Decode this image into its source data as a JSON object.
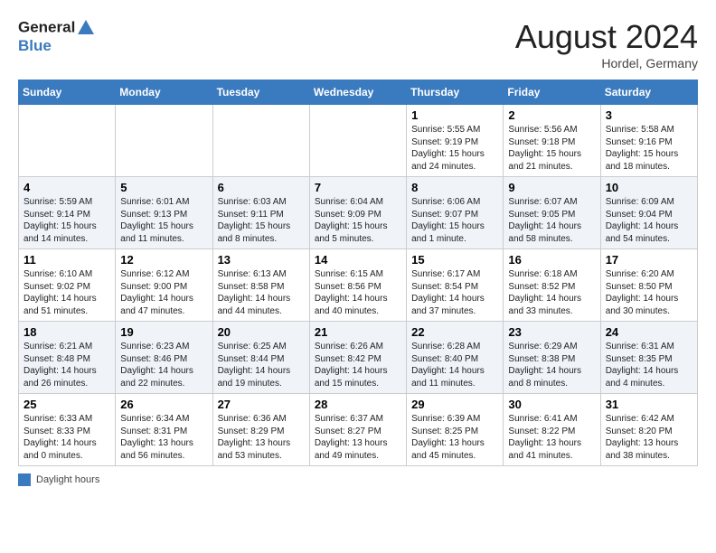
{
  "header": {
    "logo_line1": "General",
    "logo_line2": "Blue",
    "month_title": "August 2024",
    "location": "Hordel, Germany"
  },
  "days_of_week": [
    "Sunday",
    "Monday",
    "Tuesday",
    "Wednesday",
    "Thursday",
    "Friday",
    "Saturday"
  ],
  "weeks": [
    [
      {
        "day": "",
        "content": ""
      },
      {
        "day": "",
        "content": ""
      },
      {
        "day": "",
        "content": ""
      },
      {
        "day": "",
        "content": ""
      },
      {
        "day": "1",
        "content": "Sunrise: 5:55 AM\nSunset: 9:19 PM\nDaylight: 15 hours\nand 24 minutes."
      },
      {
        "day": "2",
        "content": "Sunrise: 5:56 AM\nSunset: 9:18 PM\nDaylight: 15 hours\nand 21 minutes."
      },
      {
        "day": "3",
        "content": "Sunrise: 5:58 AM\nSunset: 9:16 PM\nDaylight: 15 hours\nand 18 minutes."
      }
    ],
    [
      {
        "day": "4",
        "content": "Sunrise: 5:59 AM\nSunset: 9:14 PM\nDaylight: 15 hours\nand 14 minutes."
      },
      {
        "day": "5",
        "content": "Sunrise: 6:01 AM\nSunset: 9:13 PM\nDaylight: 15 hours\nand 11 minutes."
      },
      {
        "day": "6",
        "content": "Sunrise: 6:03 AM\nSunset: 9:11 PM\nDaylight: 15 hours\nand 8 minutes."
      },
      {
        "day": "7",
        "content": "Sunrise: 6:04 AM\nSunset: 9:09 PM\nDaylight: 15 hours\nand 5 minutes."
      },
      {
        "day": "8",
        "content": "Sunrise: 6:06 AM\nSunset: 9:07 PM\nDaylight: 15 hours\nand 1 minute."
      },
      {
        "day": "9",
        "content": "Sunrise: 6:07 AM\nSunset: 9:05 PM\nDaylight: 14 hours\nand 58 minutes."
      },
      {
        "day": "10",
        "content": "Sunrise: 6:09 AM\nSunset: 9:04 PM\nDaylight: 14 hours\nand 54 minutes."
      }
    ],
    [
      {
        "day": "11",
        "content": "Sunrise: 6:10 AM\nSunset: 9:02 PM\nDaylight: 14 hours\nand 51 minutes."
      },
      {
        "day": "12",
        "content": "Sunrise: 6:12 AM\nSunset: 9:00 PM\nDaylight: 14 hours\nand 47 minutes."
      },
      {
        "day": "13",
        "content": "Sunrise: 6:13 AM\nSunset: 8:58 PM\nDaylight: 14 hours\nand 44 minutes."
      },
      {
        "day": "14",
        "content": "Sunrise: 6:15 AM\nSunset: 8:56 PM\nDaylight: 14 hours\nand 40 minutes."
      },
      {
        "day": "15",
        "content": "Sunrise: 6:17 AM\nSunset: 8:54 PM\nDaylight: 14 hours\nand 37 minutes."
      },
      {
        "day": "16",
        "content": "Sunrise: 6:18 AM\nSunset: 8:52 PM\nDaylight: 14 hours\nand 33 minutes."
      },
      {
        "day": "17",
        "content": "Sunrise: 6:20 AM\nSunset: 8:50 PM\nDaylight: 14 hours\nand 30 minutes."
      }
    ],
    [
      {
        "day": "18",
        "content": "Sunrise: 6:21 AM\nSunset: 8:48 PM\nDaylight: 14 hours\nand 26 minutes."
      },
      {
        "day": "19",
        "content": "Sunrise: 6:23 AM\nSunset: 8:46 PM\nDaylight: 14 hours\nand 22 minutes."
      },
      {
        "day": "20",
        "content": "Sunrise: 6:25 AM\nSunset: 8:44 PM\nDaylight: 14 hours\nand 19 minutes."
      },
      {
        "day": "21",
        "content": "Sunrise: 6:26 AM\nSunset: 8:42 PM\nDaylight: 14 hours\nand 15 minutes."
      },
      {
        "day": "22",
        "content": "Sunrise: 6:28 AM\nSunset: 8:40 PM\nDaylight: 14 hours\nand 11 minutes."
      },
      {
        "day": "23",
        "content": "Sunrise: 6:29 AM\nSunset: 8:38 PM\nDaylight: 14 hours\nand 8 minutes."
      },
      {
        "day": "24",
        "content": "Sunrise: 6:31 AM\nSunset: 8:35 PM\nDaylight: 14 hours\nand 4 minutes."
      }
    ],
    [
      {
        "day": "25",
        "content": "Sunrise: 6:33 AM\nSunset: 8:33 PM\nDaylight: 14 hours\nand 0 minutes."
      },
      {
        "day": "26",
        "content": "Sunrise: 6:34 AM\nSunset: 8:31 PM\nDaylight: 13 hours\nand 56 minutes."
      },
      {
        "day": "27",
        "content": "Sunrise: 6:36 AM\nSunset: 8:29 PM\nDaylight: 13 hours\nand 53 minutes."
      },
      {
        "day": "28",
        "content": "Sunrise: 6:37 AM\nSunset: 8:27 PM\nDaylight: 13 hours\nand 49 minutes."
      },
      {
        "day": "29",
        "content": "Sunrise: 6:39 AM\nSunset: 8:25 PM\nDaylight: 13 hours\nand 45 minutes."
      },
      {
        "day": "30",
        "content": "Sunrise: 6:41 AM\nSunset: 8:22 PM\nDaylight: 13 hours\nand 41 minutes."
      },
      {
        "day": "31",
        "content": "Sunrise: 6:42 AM\nSunset: 8:20 PM\nDaylight: 13 hours\nand 38 minutes."
      }
    ]
  ],
  "footer": {
    "legend_label": "Daylight hours"
  }
}
